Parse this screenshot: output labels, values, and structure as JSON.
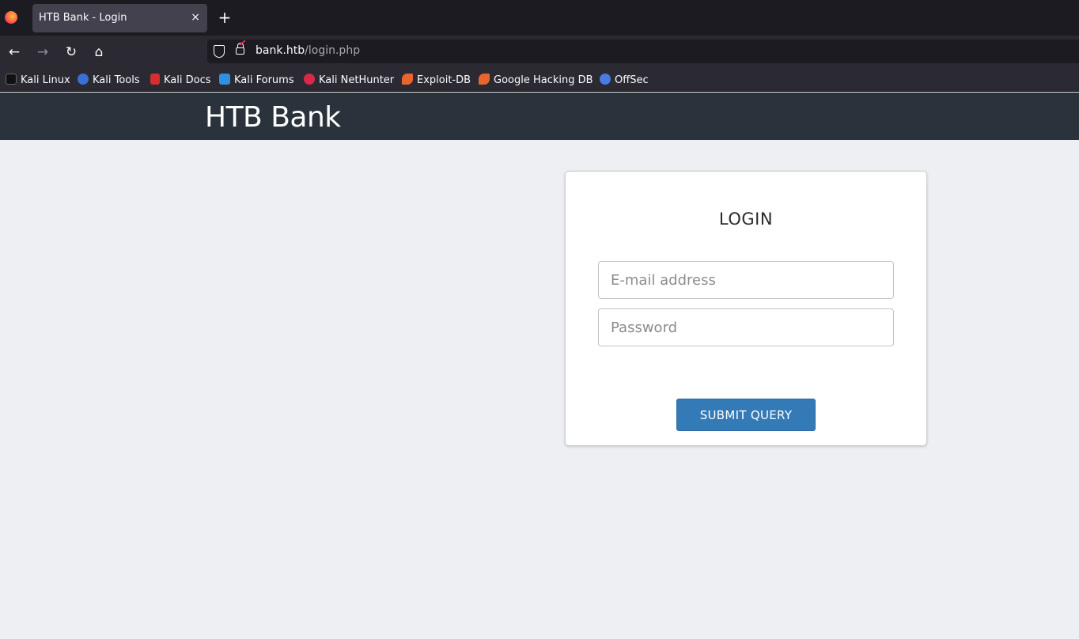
{
  "browser": {
    "tab": {
      "title": "HTB Bank - Login",
      "close_glyph": "×"
    },
    "new_tab_glyph": "+",
    "nav": {
      "back_glyph": "←",
      "forward_glyph": "→",
      "reload_glyph": "↻",
      "home_glyph": "⌂"
    },
    "url": {
      "domain": "bank.htb",
      "path": "/login.php"
    },
    "bookmarks": [
      {
        "label": "Kali Linux",
        "icon": "kali-dragon-icon",
        "color": "#1c1b22"
      },
      {
        "label": "Kali Tools",
        "icon": "kali-tools-icon",
        "color": "#3b6fd8"
      },
      {
        "label": "Kali Docs",
        "icon": "kali-docs-icon",
        "color": "#d32f2f"
      },
      {
        "label": "Kali Forums",
        "icon": "kali-forums-icon",
        "color": "#2f8fe0"
      },
      {
        "label": "Kali NetHunter",
        "icon": "nethunter-icon",
        "color": "#d8294a"
      },
      {
        "label": "Exploit-DB",
        "icon": "exploit-db-icon",
        "color": "#e8662d"
      },
      {
        "label": "Google Hacking DB",
        "icon": "ghdb-icon",
        "color": "#e8662d"
      },
      {
        "label": "OffSec",
        "icon": "offsec-icon",
        "color": "#4a7be0"
      }
    ]
  },
  "page": {
    "site_title": "HTB Bank",
    "login": {
      "heading": "LOGIN",
      "email_placeholder": "E-mail address",
      "password_placeholder": "Password",
      "submit_label": "SUBMIT QUERY"
    }
  },
  "colors": {
    "header_bg": "#2a333c",
    "page_bg": "#edeff2",
    "button_bg": "#337ab7"
  }
}
